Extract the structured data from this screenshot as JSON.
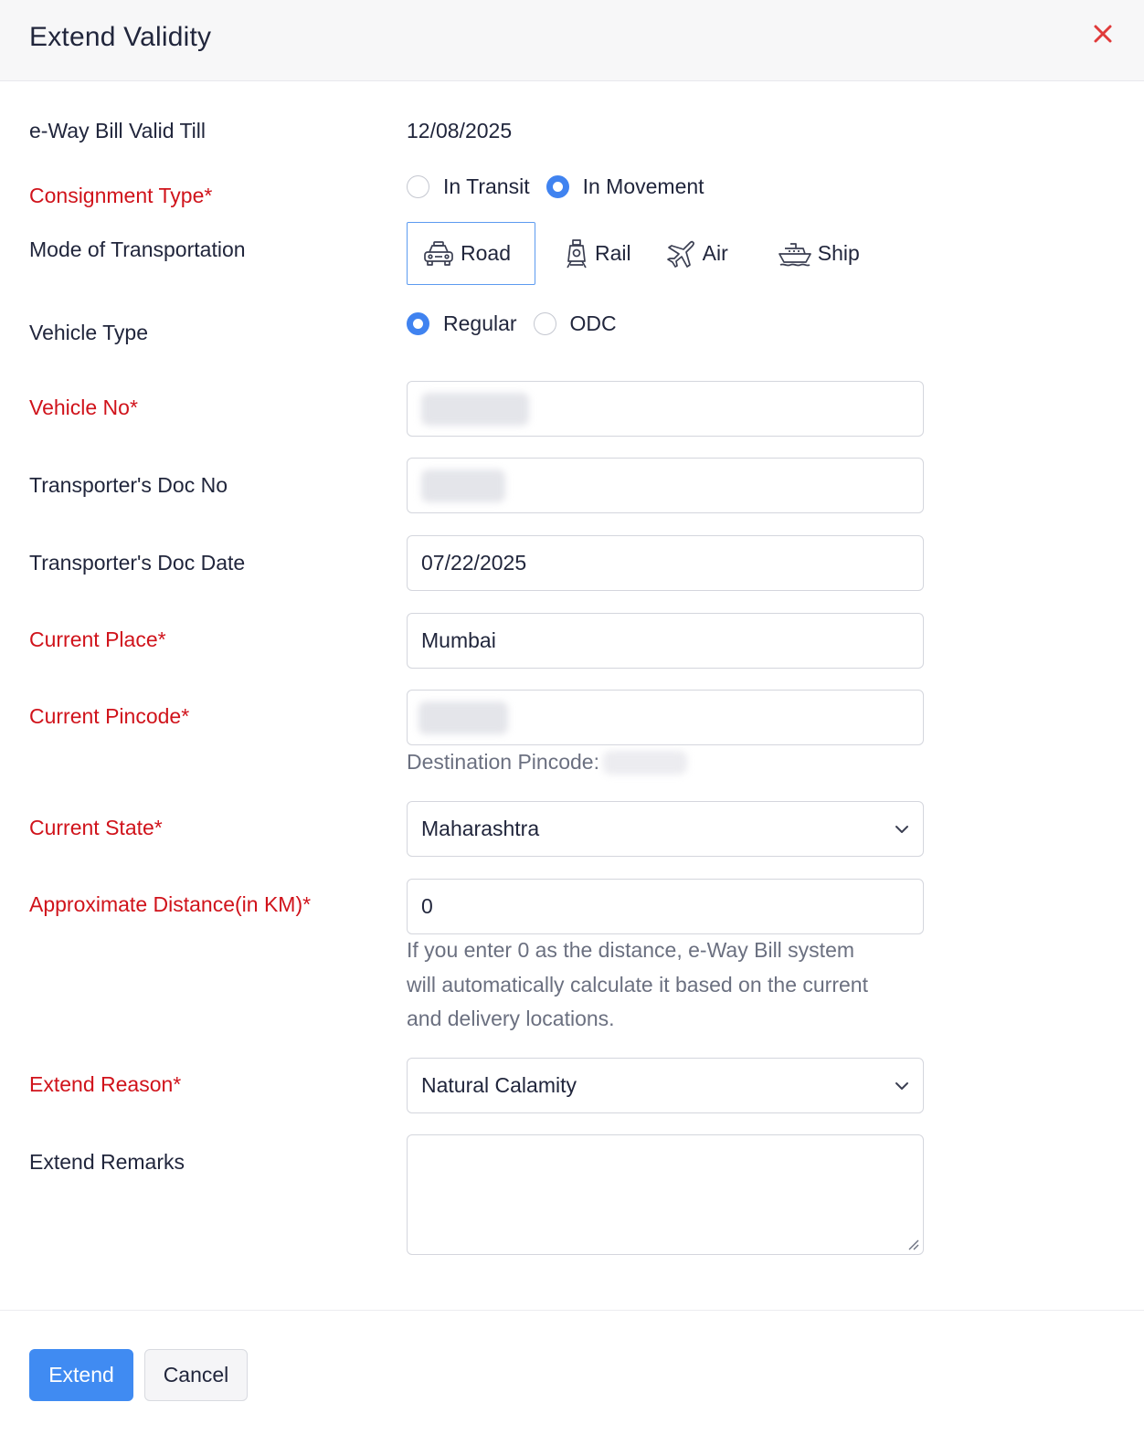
{
  "dialog": {
    "title": "Extend Validity",
    "close_icon": "close-icon",
    "close_color": "#e03a3a"
  },
  "valid_till": {
    "label": "e-Way Bill Valid Till",
    "value": "12/08/2025"
  },
  "consignment_type": {
    "label": "Consignment Type*",
    "options": [
      "In Transit",
      "In Movement"
    ],
    "selected": "In Movement"
  },
  "mode": {
    "label": "Mode of Transportation",
    "options": [
      {
        "label": "Road",
        "icon": "car-icon",
        "active": true
      },
      {
        "label": "Rail",
        "icon": "train-icon",
        "active": false
      },
      {
        "label": "Air",
        "icon": "airplane-icon",
        "active": false
      },
      {
        "label": "Ship",
        "icon": "ship-icon",
        "active": false
      }
    ]
  },
  "vehicle_type": {
    "label": "Vehicle Type",
    "options": [
      "Regular",
      "ODC"
    ],
    "selected": "Regular"
  },
  "vehicle_no": {
    "label": "Vehicle No*"
  },
  "doc_no": {
    "label": "Transporter's Doc No"
  },
  "doc_date": {
    "label": "Transporter's Doc Date",
    "value": "07/22/2025"
  },
  "current_place": {
    "label": "Current Place*",
    "value": "Mumbai"
  },
  "current_pincode": {
    "label": "Current Pincode*",
    "hint": "Destination Pincode:"
  },
  "current_state": {
    "label": "Current State*",
    "value": "Maharashtra"
  },
  "distance": {
    "label": "Approximate Distance(in KM)*",
    "value": "0",
    "hint_lines": [
      "If you enter 0 as the distance, e-Way Bill system",
      "will automatically calculate it based on the current",
      "and delivery locations."
    ]
  },
  "extend_reason": {
    "label": "Extend Reason*",
    "value": "Natural Calamity"
  },
  "extend_remarks": {
    "label": "Extend Remarks",
    "value": ""
  },
  "footer": {
    "extend_label": "Extend",
    "cancel_label": "Cancel"
  },
  "colors": {
    "required": "#d0131b",
    "accent": "#408bf2"
  }
}
